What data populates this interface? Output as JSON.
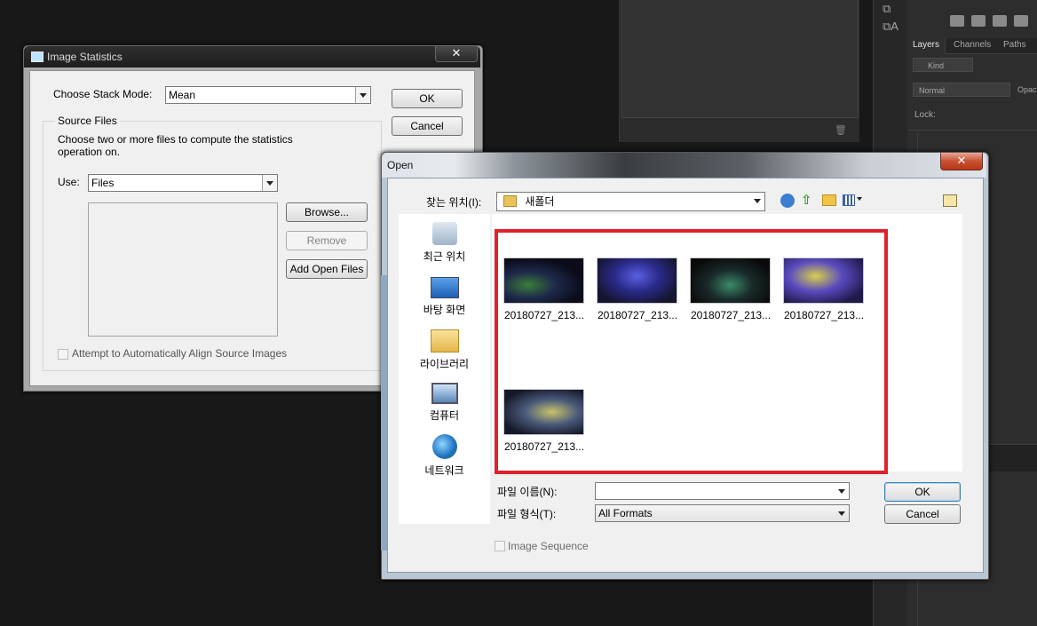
{
  "photoshop": {
    "panel_tabs": [
      "Layers",
      "Channels",
      "Paths"
    ],
    "filter_kind": "Kind",
    "blend_mode": "Normal",
    "opacity_label": "Opac",
    "lock_label": "Lock:"
  },
  "image_statistics": {
    "title": "Image Statistics",
    "close_label": "✕",
    "stack_mode_label": "Choose Stack Mode:",
    "stack_mode_value": "Mean",
    "ok_label": "OK",
    "cancel_label": "Cancel",
    "source_files_title": "Source Files",
    "source_files_desc_line1": "Choose two or more files to compute the statistics",
    "source_files_desc_line2": "operation on.",
    "use_label": "Use:",
    "use_value": "Files",
    "browse_label": "Browse...",
    "remove_label": "Remove",
    "add_open_files_label": "Add Open Files",
    "align_checkbox_label": "Attempt to Automatically Align Source Images"
  },
  "open_dialog": {
    "title": "Open",
    "close_label": "✕",
    "look_in_label": "찾는 위치(I):",
    "look_in_value": "새폴더",
    "places": [
      {
        "label": "최근 위치",
        "icon": "recent-places-icon"
      },
      {
        "label": "바탕 화면",
        "icon": "desktop-icon"
      },
      {
        "label": "라이브러리",
        "icon": "library-icon"
      },
      {
        "label": "컴퓨터",
        "icon": "computer-icon"
      },
      {
        "label": "네트워크",
        "icon": "network-icon"
      }
    ],
    "files": [
      {
        "name": "20180727_213..."
      },
      {
        "name": "20180727_213..."
      },
      {
        "name": "20180727_213..."
      },
      {
        "name": "20180727_213..."
      },
      {
        "name": "20180727_213..."
      }
    ],
    "file_name_label": "파일 이름(N):",
    "file_name_value": "",
    "file_type_label": "파일 형식(T):",
    "file_type_value": "All Formats",
    "ok_label": "OK",
    "cancel_label": "Cancel",
    "image_sequence_label": "Image Sequence"
  },
  "colors": {
    "highlight_box": "#e0212a",
    "ps_background": "#181818"
  }
}
